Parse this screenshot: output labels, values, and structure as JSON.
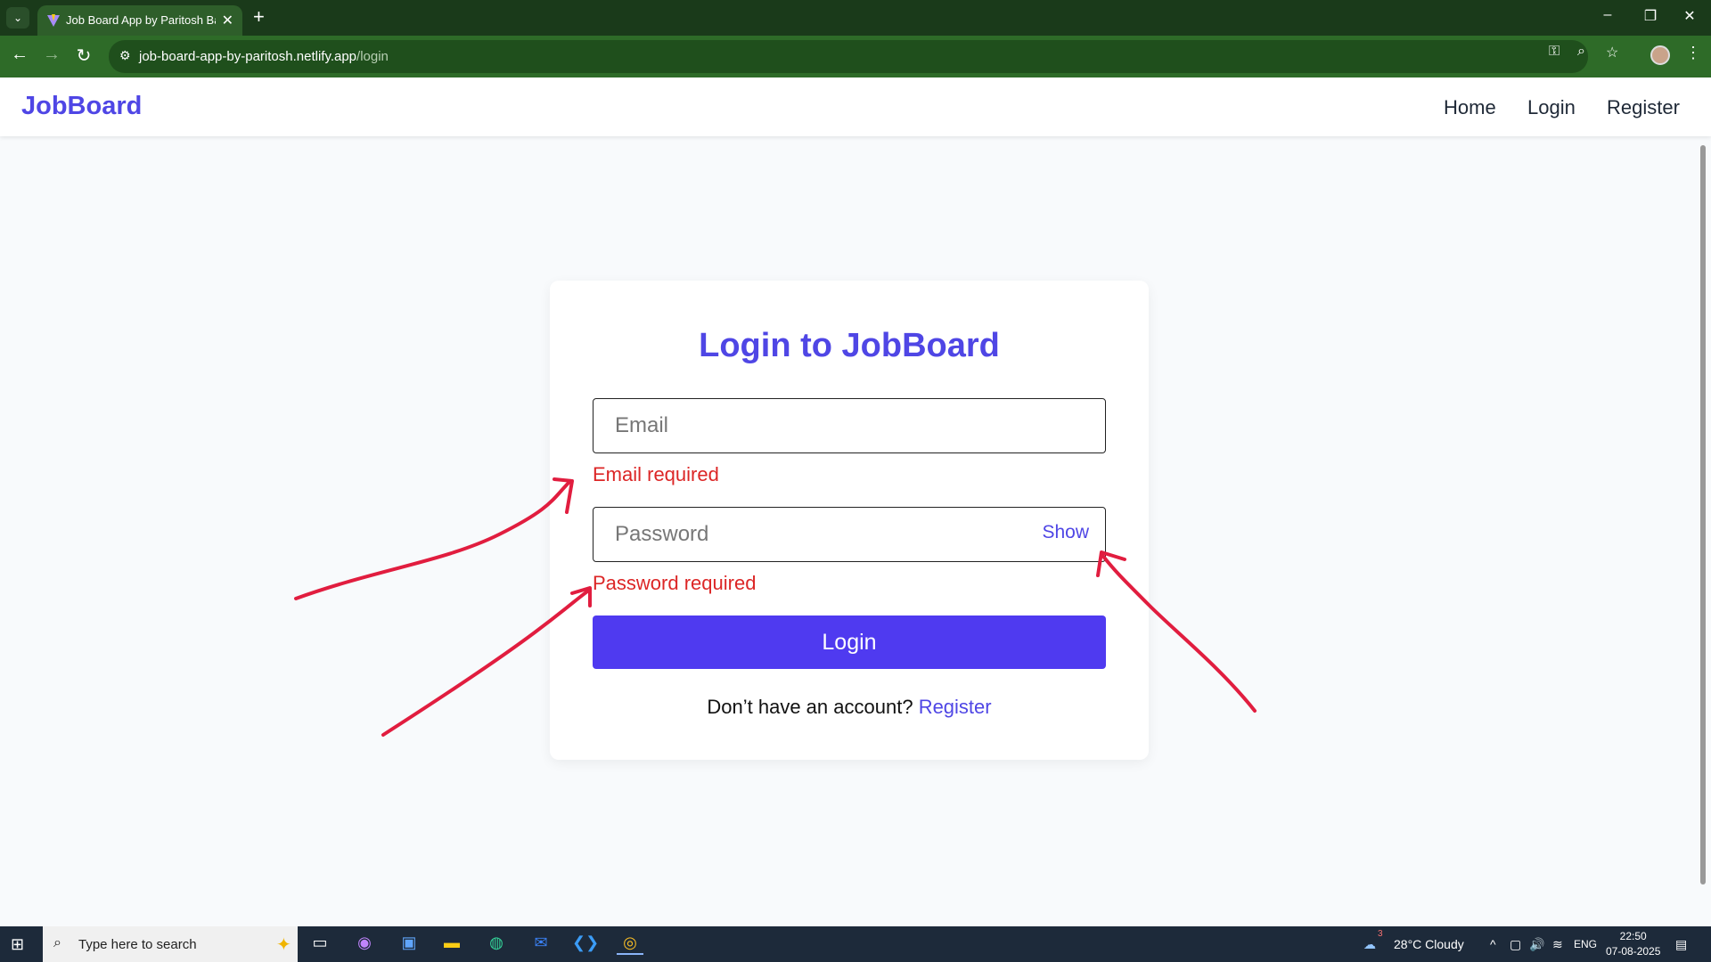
{
  "browser": {
    "tab_title": "Job Board App by Paritosh Barman",
    "url_host": "job-board-app-by-paritosh.netlify.app",
    "url_path": "/login"
  },
  "navbar": {
    "brand": "JobBoard",
    "links": [
      "Home",
      "Login",
      "Register"
    ]
  },
  "login_form": {
    "title": "Login to JobBoard",
    "email_placeholder": "Email",
    "email_error": "Email required",
    "password_placeholder": "Password",
    "password_toggle": "Show",
    "password_error": "Password required",
    "submit_label": "Login",
    "signup_prompt": "Don’t have an account?",
    "signup_link": "Register"
  },
  "taskbar": {
    "search_placeholder": "Type here to search",
    "weather_badge": "3",
    "weather": "28°C  Cloudy",
    "language": "ENG",
    "time": "22:50",
    "date": "07-08-2025"
  },
  "colors": {
    "accent": "#4f46e5",
    "button": "#4f3af0",
    "error": "#dc2626",
    "annotation": "#e11d3f",
    "chrome": "#2e6b28"
  }
}
